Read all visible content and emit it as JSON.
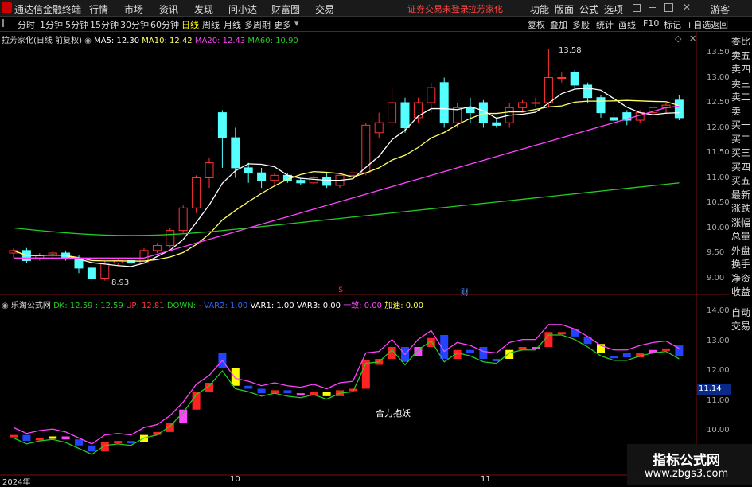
{
  "titlebar": {
    "app_title": "通达信金融终端",
    "menus": [
      "行情",
      "市场",
      "资讯",
      "发现",
      "问小达",
      "财富圈",
      "交易"
    ],
    "warning": "证券交易未登录",
    "warning2": "拉芳家化",
    "right_menus": [
      "功能",
      "版面",
      "公式",
      "选项"
    ],
    "guest": "游客"
  },
  "periods": [
    "分时",
    "1分钟",
    "5分钟",
    "15分钟",
    "30分钟",
    "60分钟",
    "日线",
    "周线",
    "月线",
    "多周期",
    "更多"
  ],
  "active_period": "日线",
  "tools": [
    "复权",
    "叠加",
    "多股",
    "统计",
    "画线",
    "F10",
    "标记",
    "+自选",
    "返回"
  ],
  "main_chart": {
    "stock": "拉芳家化(日线 前复权)",
    "ma": [
      {
        "label": "MA5: 12.30",
        "color": "#ffffff"
      },
      {
        "label": "MA10: 12.42",
        "color": "#ffff66"
      },
      {
        "label": "MA20: 12.43",
        "color": "#ff44ff"
      },
      {
        "label": "MA60: 10.90",
        "color": "#22cc22"
      }
    ],
    "y_ticks": [
      "13.50",
      "13.00",
      "12.50",
      "12.00",
      "11.50",
      "11.00",
      "10.50",
      "10.00",
      "9.50",
      "9.00"
    ],
    "high_label": "13.58",
    "low_label": "8.93",
    "marks": [
      "$",
      "财"
    ]
  },
  "sub_chart": {
    "name": "乐淘公式网",
    "legend": [
      {
        "label": "DK: 12.59 : 12.59",
        "color": "#22cc22"
      },
      {
        "label": "UP: 12.81",
        "color": "#ff3333"
      },
      {
        "label": "DOWN: -",
        "color": "#22cc22"
      },
      {
        "label": "VAR2: 1.00",
        "color": "#3366ff"
      },
      {
        "label": "VAR1: 1.00",
        "color": "#ffffff"
      },
      {
        "label": "VAR3: 0.00",
        "color": "#ffffff"
      },
      {
        "label": "一致: 0.00",
        "color": "#ff44ff"
      },
      {
        "label": "加速: 0.00",
        "color": "#ffff44"
      }
    ],
    "y_ticks": [
      "14.00",
      "13.00",
      "12.00",
      "11.00",
      "10.00"
    ],
    "current_tag": "11.14",
    "annotation": "合力抱妖"
  },
  "right_panel": [
    "委比",
    "卖五",
    "卖四",
    "卖三",
    "卖二",
    "卖一",
    "买一",
    "买二",
    "买三",
    "买四",
    "买五",
    "最新",
    "涨跌",
    "涨幅",
    "总量",
    "外盘",
    "换手",
    "净资",
    "收益"
  ],
  "right_panel2": [
    "自动",
    "交易"
  ],
  "x_axis": [
    "2024年",
    "10",
    "11"
  ],
  "watermark": {
    "line1": "指标公式网",
    "line2": "www.zbgs3.com"
  },
  "colors": {
    "up": "#ff3333",
    "down": "#54ffff",
    "bg": "#000000"
  }
}
